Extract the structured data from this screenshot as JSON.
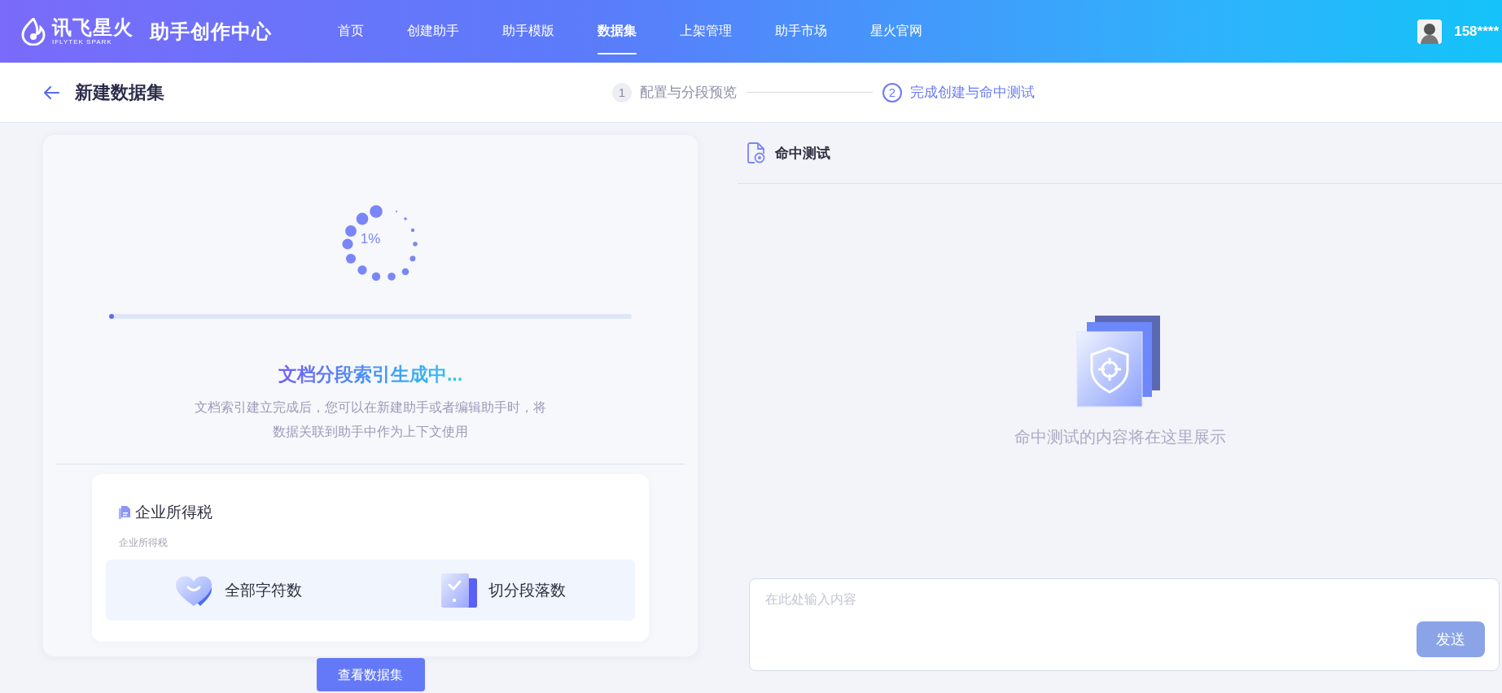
{
  "header": {
    "logo_text": "讯飞星火",
    "logo_subtext": "IFLYTEK SPARK",
    "product": "助手创作中心",
    "nav": [
      {
        "label": "首页",
        "selected": false
      },
      {
        "label": "创建助手",
        "selected": false
      },
      {
        "label": "助手模版",
        "selected": false
      },
      {
        "label": "数据集",
        "selected": true
      },
      {
        "label": "上架管理",
        "selected": false
      },
      {
        "label": "助手市场",
        "selected": false
      },
      {
        "label": "星火官网",
        "selected": false
      }
    ],
    "user": "158****"
  },
  "page": {
    "title": "新建数据集",
    "steps": [
      {
        "number": "1",
        "label": "配置与分段预览",
        "selected": false
      },
      {
        "number": "2",
        "label": "完成创建与命中测试",
        "selected": true
      }
    ]
  },
  "progress": {
    "percent": "1%",
    "level": 0.01,
    "title": "文档分段索引生成中...",
    "description": "文档索引建立完成后，您可以在新建助手或者编辑助手时，将数据关联到助手中作为上下文使用"
  },
  "dataset": {
    "name": "企业所得税",
    "description": "企业所得税",
    "stats": [
      {
        "kind": "characters",
        "label": "全部字符数"
      },
      {
        "kind": "paragraphs",
        "label": "切分段落数"
      }
    ]
  },
  "view_button": "查看数据集",
  "hit_test": {
    "title": "命中测试",
    "empty_text": "命中测试的内容将在这里展示",
    "input": {
      "placeholder": "在此处输入内容"
    },
    "send_button": "发送"
  }
}
